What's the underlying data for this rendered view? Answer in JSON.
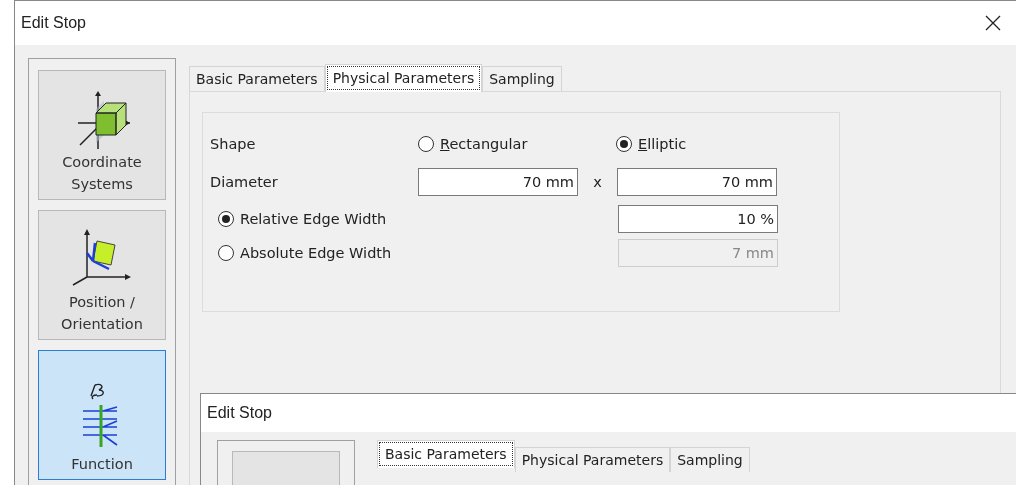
{
  "window": {
    "title": "Edit Stop"
  },
  "sidebar": {
    "items": [
      {
        "label": "Coordinate Systems",
        "kind": "coords",
        "selected": false
      },
      {
        "label": "Position / Orientation",
        "kind": "position",
        "selected": false
      },
      {
        "label": "Function",
        "kind": "function",
        "selected": true
      }
    ]
  },
  "tabs": [
    {
      "label": "Basic Parameters",
      "selected": false
    },
    {
      "label": "Physical Parameters",
      "selected": true
    },
    {
      "label": "Sampling",
      "selected": false
    }
  ],
  "shape": {
    "label": "Shape",
    "options": [
      {
        "label": "Rectangular",
        "selected": false
      },
      {
        "label": "Elliptic",
        "selected": true
      }
    ]
  },
  "diameter": {
    "label": "Diameter",
    "x": "70 mm",
    "separator": "x",
    "y": "70 mm"
  },
  "edge": {
    "options": [
      {
        "label": "Relative Edge Width",
        "selected": true,
        "value": "10 %",
        "disabled": false
      },
      {
        "label": "Absolute Edge Width",
        "selected": false,
        "value": "7 mm",
        "disabled": true
      }
    ]
  },
  "second_window": {
    "title": "Edit Stop",
    "tabs": [
      {
        "label": "Basic Parameters",
        "selected": true
      },
      {
        "label": "Physical Parameters",
        "selected": false
      },
      {
        "label": "Sampling",
        "selected": false
      }
    ]
  }
}
